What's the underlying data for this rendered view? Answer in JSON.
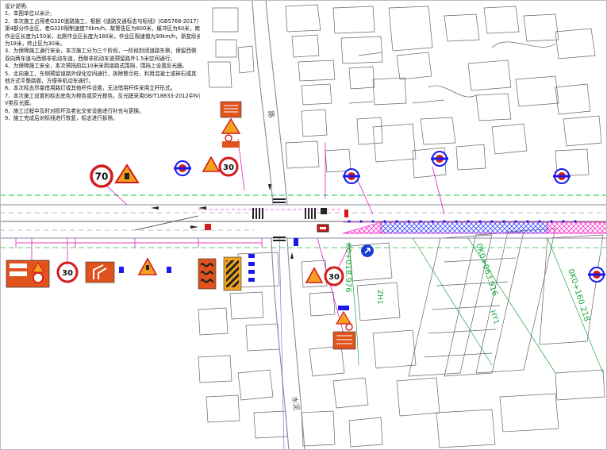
{
  "notes": {
    "title": "设计说明:",
    "lines": [
      "1、本图单位以米计;",
      "2、本次施工占用老G320道路施工，根据《道路交通标志与标线》(GB5768-2017)",
      "第4部分作业区，老G320限制速度70km/h，故警告区为600米，缓冲区为60米，南侧",
      "作业区长度为150米，北侧作业区长度为180米，作业区限速值为30km/h，渐变段长度",
      "为18米，终止区为30米。",
      "3、为保障施工通行安全，本次施工分为三个阶段，一阶段封闭道路东侧，保留西侧",
      "双向两车道与西侧非机动车道，西侧非机动车道预留路外1.5米空间通行。",
      "4、为保障施工安全，本次预挡前后10米采用道路式围挡，围挡上设置反光膜。",
      "5、北向施工，东侧预留道路外绿化空间通行，拆除警示柱，利用混凝土或碎石或其",
      "他方式平整路面，方便非机动车通行。",
      "6、本次标志尽量借用路灯或其他杆件设置，无法借用杆件采用立杆形式。",
      "7、本次施工设置的标志底色为橙色或荧光橙色，反光膜采用GB/T18833-2012中Ⅳ类、",
      "Ⅴ类反光膜。",
      "8、施工过程中及时对损坏及老化交安设施进行补充与更换。",
      "9、施工完成后对标线进行恢复，标志进行拆除。"
    ]
  },
  "signs": {
    "speed_70": "70",
    "speed_30": "30"
  },
  "labels": {
    "stake_left": "K0+018.976",
    "stake_mid": "0K0+063.916",
    "stake_right": "0K0+160.218",
    "zh": "ZH1",
    "hy": "HY1",
    "road_name_north": "路",
    "road_name_south": "水泥"
  },
  "colors": {
    "road_edge": "#8a8aa0",
    "building": "#666666",
    "centerline_green": "#22bb44",
    "work_zone": "#3344ff",
    "taper_magenta": "#ff33cc",
    "sign_orange": "#e0531d",
    "sign_red": "#d41a1a",
    "survey_green": "#1ca83a",
    "dim_magenta": "#e000b0"
  }
}
